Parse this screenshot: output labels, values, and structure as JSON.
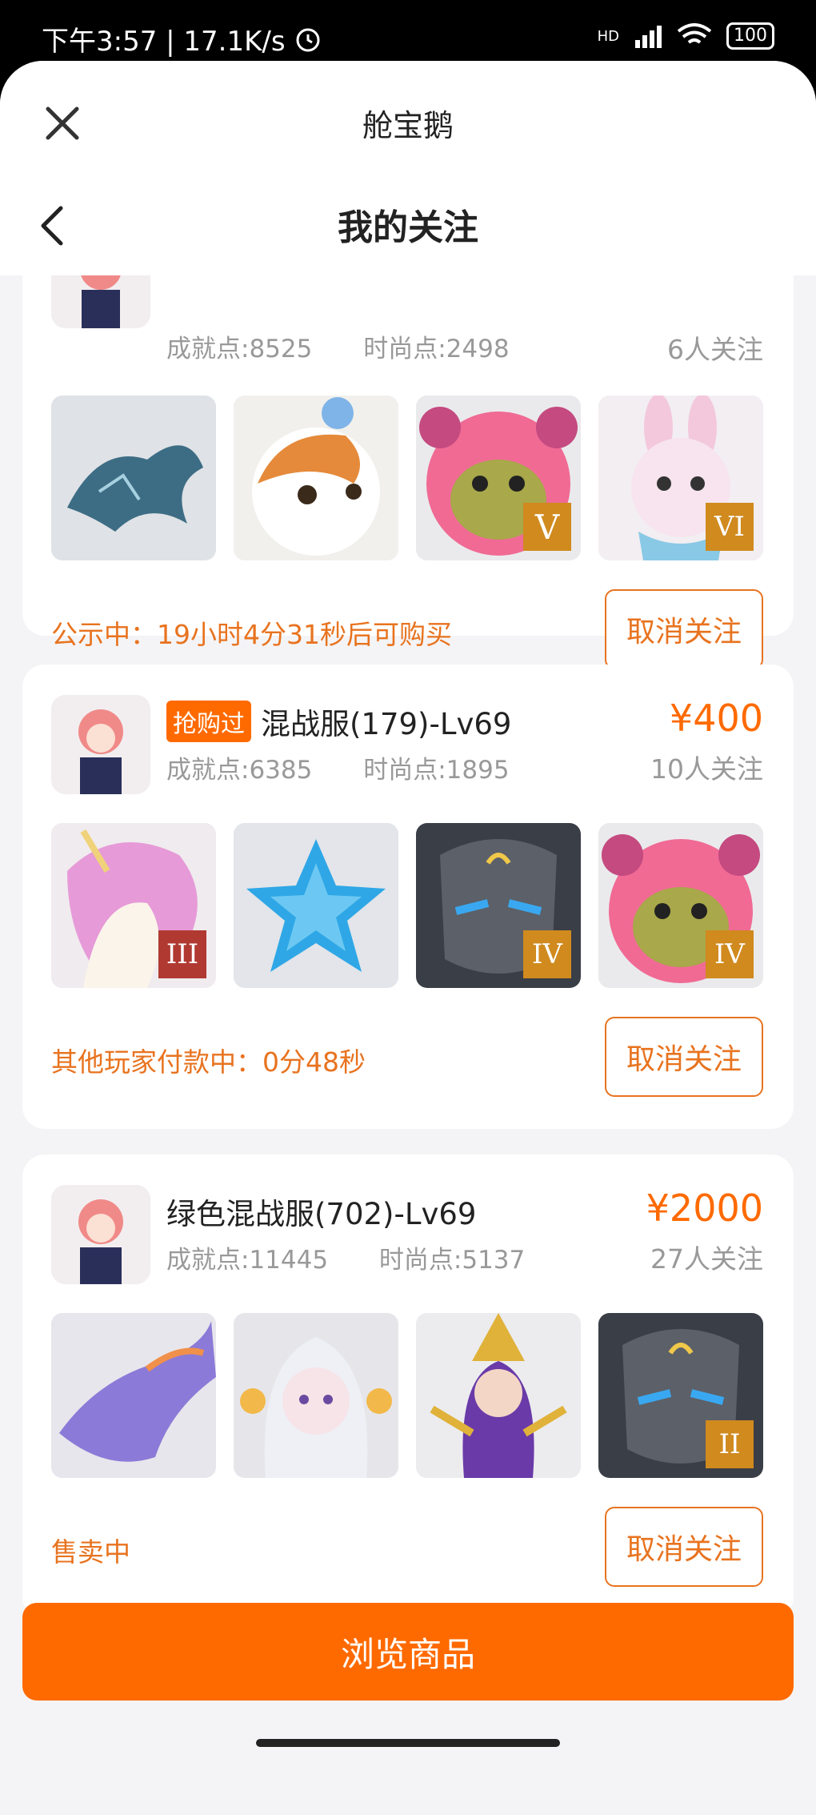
{
  "status_bar": {
    "time_text": "下午3:57 | 17.1K/s",
    "battery": "100",
    "network": "HD"
  },
  "header": {
    "app_title": "舱宝鹅",
    "page_title": "我的关注"
  },
  "cards": [
    {
      "achievement": "成就点:8525",
      "fashion": "时尚点:2498",
      "followers": "6人关注",
      "items": [
        {
          "name": "blue-dragon",
          "rank": ""
        },
        {
          "name": "calico-cat",
          "rank": ""
        },
        {
          "name": "pink-bear",
          "rank": "V"
        },
        {
          "name": "bunny",
          "rank": "VI"
        }
      ],
      "status": "公示中：19小时4分31秒后可购买",
      "button": "取消关注"
    },
    {
      "tag": "抢购过",
      "title": "混战服(179)-Lv69",
      "price": "¥400",
      "achievement": "成就点:6385",
      "fashion": "时尚点:1895",
      "followers": "10人关注",
      "items": [
        {
          "name": "unicorn",
          "rank": "III"
        },
        {
          "name": "blue-star-pillow",
          "rank": ""
        },
        {
          "name": "stone-mask",
          "rank": "IV"
        },
        {
          "name": "pink-bear",
          "rank": "IV"
        }
      ],
      "status": "其他玩家付款中：0分48秒",
      "button": "取消关注"
    },
    {
      "title": "绿色混战服(702)-Lv69",
      "price": "¥2000",
      "achievement": "成就点:11445",
      "fashion": "时尚点:5137",
      "followers": "27人关注",
      "items": [
        {
          "name": "purple-dragon",
          "rank": ""
        },
        {
          "name": "white-haired-fairy",
          "rank": ""
        },
        {
          "name": "golden-warrior",
          "rank": ""
        },
        {
          "name": "stone-mask",
          "rank": "II"
        }
      ],
      "status": "售卖中",
      "button": "取消关注"
    }
  ],
  "footer": {
    "browse_label": "浏览商品"
  },
  "colors": {
    "accent": "#ff6a00",
    "status_text": "#e8731f"
  }
}
